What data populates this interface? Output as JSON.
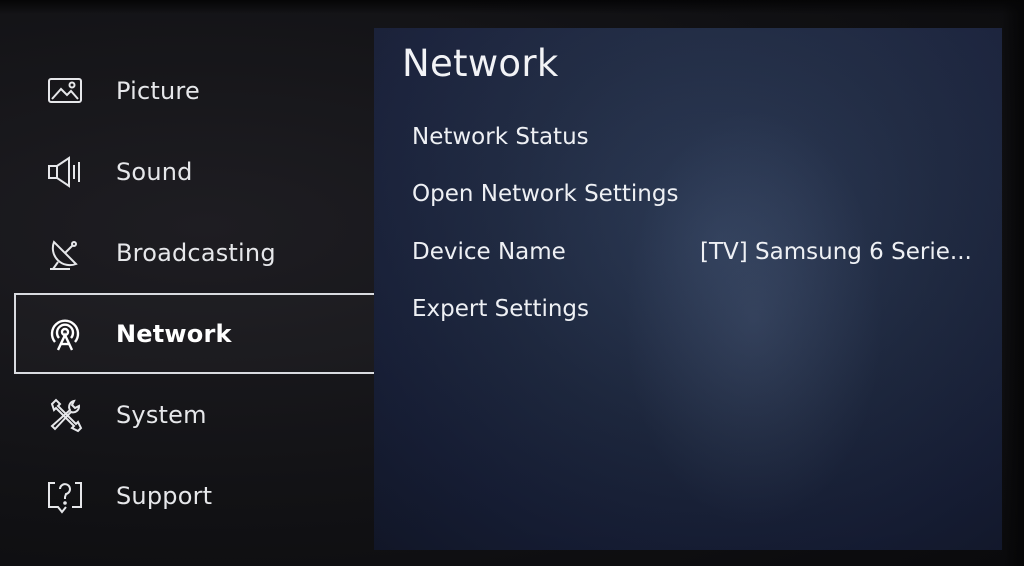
{
  "sidebar": {
    "items": [
      {
        "label": "Picture",
        "icon": "picture-icon",
        "selected": false
      },
      {
        "label": "Sound",
        "icon": "speaker-icon",
        "selected": false
      },
      {
        "label": "Broadcasting",
        "icon": "satellite-dish-icon",
        "selected": false
      },
      {
        "label": "Network",
        "icon": "network-icon",
        "selected": true
      },
      {
        "label": "System",
        "icon": "tools-icon",
        "selected": false
      },
      {
        "label": "Support",
        "icon": "help-icon",
        "selected": false
      }
    ]
  },
  "main": {
    "title": "Network",
    "rows": [
      {
        "label": "Network Status",
        "value": ""
      },
      {
        "label": "Open Network Settings",
        "value": ""
      },
      {
        "label": "Device Name",
        "value": "[TV] Samsung 6 Serie..."
      },
      {
        "label": "Expert Settings",
        "value": ""
      }
    ]
  },
  "colors": {
    "panel": "#1f2a43",
    "selection_border": "#d9dbe0",
    "text": "#eef0f4"
  }
}
